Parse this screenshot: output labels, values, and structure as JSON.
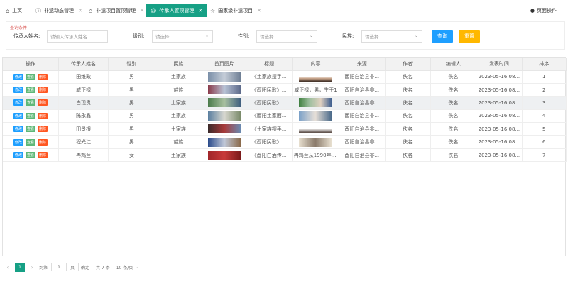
{
  "tabs": [
    {
      "icon": "⌂",
      "label": "主页",
      "closable": false
    },
    {
      "icon": "ⓘ",
      "label": "非遗动态管理",
      "closable": true
    },
    {
      "icon": "♙",
      "label": "非遗项目置顶管理",
      "closable": true
    },
    {
      "icon": "☺",
      "label": "传承人置顶管理",
      "closable": true,
      "active": true
    },
    {
      "icon": "☆",
      "label": "国家级非遗项目",
      "closable": true
    }
  ],
  "page_ops": "页面操作",
  "query": {
    "title": "查询条件",
    "name_label": "传承人姓名:",
    "name_placeholder": "请输入传承人姓名",
    "level_label": "级别:",
    "level_placeholder": "请选择",
    "gender_label": "性别:",
    "gender_placeholder": "请选择",
    "ethnic_label": "民族:",
    "ethnic_placeholder": "请选择",
    "search_btn": "查询",
    "reset_btn": "重置"
  },
  "table": {
    "columns": [
      "操作",
      "传承人姓名",
      "性别",
      "民族",
      "首页图片",
      "标题",
      "内容",
      "来源",
      "作者",
      "编辑人",
      "发表时间",
      "排序"
    ],
    "op_labels": {
      "edit": "修改",
      "view": "查看",
      "del": "删除"
    },
    "rows": [
      {
        "name": "田维政",
        "gender": "男",
        "ethnic": "土家族",
        "title": "《土家族摆手...",
        "content": "",
        "source": "酉阳自治县非...",
        "author": "佚名",
        "editor": "佚名",
        "time": "2023-05-16 08...",
        "order": "1"
      },
      {
        "name": "威正禄",
        "gender": "男",
        "ethnic": "苗族",
        "title": "《酉阳民歌》...",
        "content": "威正禄，男，生于1",
        "source": "酉阳自治县非...",
        "author": "佚名",
        "editor": "佚名",
        "time": "2023-05-16 08...",
        "order": "2"
      },
      {
        "name": "白现贵",
        "gender": "男",
        "ethnic": "土家族",
        "title": "《酉阳民歌》...",
        "content": "",
        "source": "酉阳自治县非...",
        "author": "佚名",
        "editor": "佚名",
        "time": "2023-05-16 08...",
        "order": "3"
      },
      {
        "name": "陈永鑫",
        "gender": "男",
        "ethnic": "土家族",
        "title": "《酉阳土家面...",
        "content": "",
        "source": "酉阳自治县非...",
        "author": "佚名",
        "editor": "佚名",
        "time": "2023-05-16 08...",
        "order": "4"
      },
      {
        "name": "田景根",
        "gender": "男",
        "ethnic": "土家族",
        "title": "《土家族摆手...",
        "content": "",
        "source": "酉阳自治县非...",
        "author": "佚名",
        "editor": "佚名",
        "time": "2023-05-16 08...",
        "order": "5"
      },
      {
        "name": "程光江",
        "gender": "男",
        "ethnic": "苗族",
        "title": "《酉阳民歌》...",
        "content": "",
        "source": "酉阳自治县非...",
        "author": "佚名",
        "editor": "佚名",
        "time": "2023-05-16 08...",
        "order": "6"
      },
      {
        "name": "冉鸡兰",
        "gender": "女",
        "ethnic": "土家族",
        "title": "《酉阳白酒传...",
        "content": "冉鸡兰从1990年开始",
        "source": "酉阳自治县非...",
        "author": "佚名",
        "editor": "佚名",
        "time": "2023-05-16 08...",
        "order": "7"
      }
    ]
  },
  "pager": {
    "current": "1",
    "goto_label": "到第",
    "goto_value": "1",
    "page_unit": "页",
    "confirm": "确定",
    "total": "共 7 条",
    "per_page": "10 条/页"
  },
  "colors": {
    "accent": "#16a085",
    "edit": "#1e9fff",
    "view": "#5fb878",
    "delete": "#ff5722",
    "search": "#1e9fff",
    "reset": "#ffb800"
  }
}
